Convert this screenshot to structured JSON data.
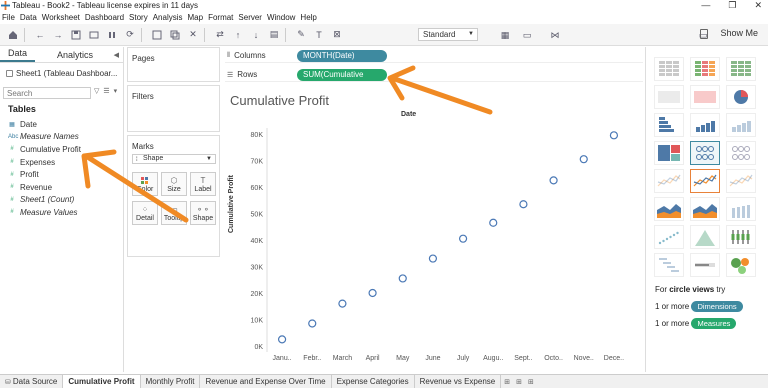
{
  "window": {
    "title": "Tableau - Book2 - Tableau license expires in 11 days",
    "controls": [
      "—",
      "❐",
      "✕"
    ]
  },
  "menu": [
    "File",
    "Data",
    "Worksheet",
    "Dashboard",
    "Story",
    "Analysis",
    "Map",
    "Format",
    "Server",
    "Window",
    "Help"
  ],
  "toolbar": {
    "fit_select": "Standard",
    "show_me_label": "Show Me"
  },
  "data_pane": {
    "tabs": [
      "Data",
      "Analytics"
    ],
    "source": "Sheet1 (Tableau Dashboar...",
    "search_placeholder": "Search",
    "tables_header": "Tables",
    "fields": [
      {
        "name": "Date",
        "kind": "dim",
        "icon": "calendar-icon",
        "italic": false
      },
      {
        "name": "Measure Names",
        "kind": "dim",
        "icon": "abc-icon",
        "italic": true
      },
      {
        "name": "Cumulative Profit",
        "kind": "measure",
        "icon": "measure-icon",
        "italic": false
      },
      {
        "name": "Expenses",
        "kind": "measure",
        "icon": "measure-icon",
        "italic": false
      },
      {
        "name": "Profit",
        "kind": "measure",
        "icon": "measure-icon",
        "italic": false
      },
      {
        "name": "Revenue",
        "kind": "measure",
        "icon": "measure-icon",
        "italic": false
      },
      {
        "name": "Sheet1 (Count)",
        "kind": "measure",
        "icon": "measure-icon",
        "italic": true
      },
      {
        "name": "Measure Values",
        "kind": "measure",
        "icon": "measure-icon",
        "italic": true
      }
    ]
  },
  "cards": {
    "pages": "Pages",
    "filters": "Filters",
    "marks": "Marks",
    "mark_type": "Shape",
    "mark_buttons": [
      "Color",
      "Size",
      "Label",
      "Detail",
      "Tooltip",
      "Shape"
    ]
  },
  "shelves": {
    "columns_label": "Columns",
    "columns_pill": "MONTH(Date)",
    "rows_label": "Rows",
    "rows_pill": "SUM(Cumulative Pro..."
  },
  "view": {
    "title": "Cumulative Profit",
    "column_header": "Date",
    "y_axis_label": "Cumulative Profit"
  },
  "show_me": {
    "hint_prefix": "For ",
    "hint_bold": "circle views",
    "hint_suffix": " try",
    "req1_prefix": "1 or more",
    "req1_pill": "Dimensions",
    "req2_prefix": "1 or more",
    "req2_pill": "Measures"
  },
  "sheet_tabs": [
    "Data Source",
    "Cumulative Profit",
    "Monthly Profit",
    "Revenue and Expense Over Time",
    "Expense Categories",
    "Revenue vs Expense"
  ],
  "colors": {
    "dimension_pill": "#3e8aa0",
    "measure_pill": "#26a86c",
    "mark_stroke": "#4a78b5",
    "annotation_arrow": "#f08a24"
  },
  "chart_data": {
    "type": "scatter",
    "title": "Cumulative Profit",
    "xlabel": "Date",
    "ylabel": "Cumulative Profit",
    "categories": [
      "Janu..",
      "Febr..",
      "March",
      "April",
      "May",
      "June",
      "July",
      "Augu..",
      "Sept..",
      "Octo..",
      "Nove..",
      "Dece.."
    ],
    "values": [
      2500,
      8500,
      16000,
      20000,
      25500,
      33000,
      40500,
      46500,
      53500,
      62500,
      70500,
      79500
    ],
    "yticks": [
      "0K",
      "10K",
      "20K",
      "30K",
      "40K",
      "50K",
      "60K",
      "70K",
      "80K"
    ],
    "ylim": [
      0,
      80000
    ],
    "marker": "open-circle",
    "grid": false
  }
}
